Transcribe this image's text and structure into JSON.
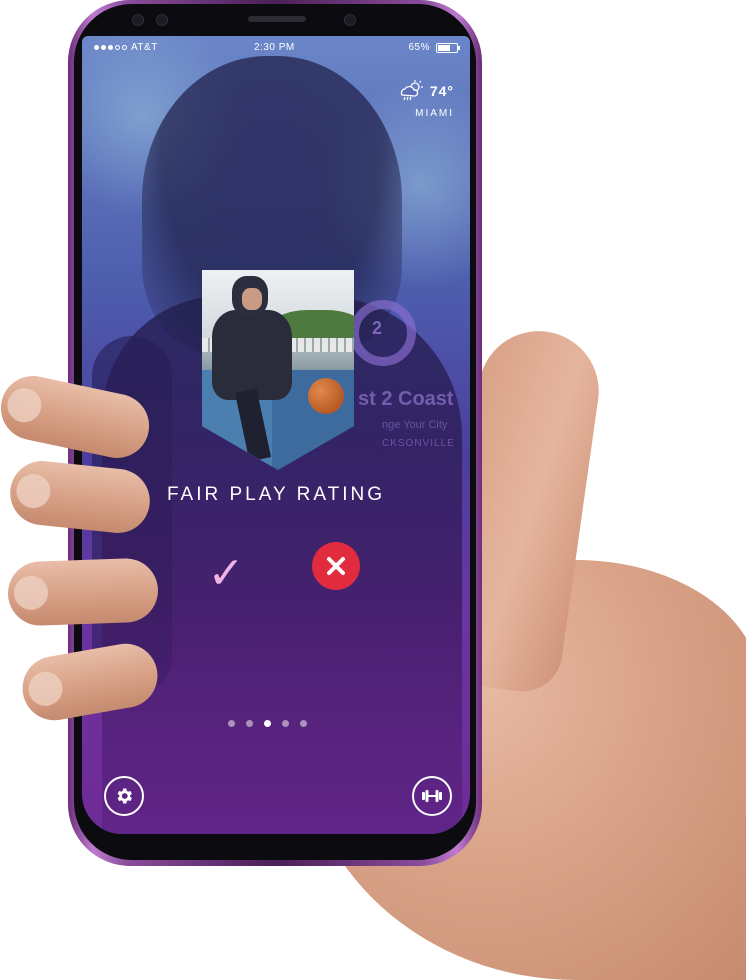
{
  "status_bar": {
    "carrier": "AT&T",
    "time": "2:30 PM",
    "battery": "65%",
    "battery_level": 0.65,
    "signal_bars_filled": 3,
    "signal_bars_total": 5
  },
  "weather": {
    "temperature": "74°",
    "city": "MIAMI",
    "icon": "cloud-rain-sun-icon"
  },
  "background_logo": {
    "mark": "2",
    "line1": "st 2 Coast",
    "line2": "nge Your City",
    "line3": "CKSONVILLE"
  },
  "rating": {
    "title": "FAIR PLAY RATING",
    "approve_icon": "check-icon",
    "reject_icon": "close-icon",
    "approve_glyph": "✓"
  },
  "pager": {
    "count": 5,
    "active_index": 2
  },
  "bottom_bar": {
    "left_icon": "gear-icon",
    "right_icon": "dumbbell-icon"
  },
  "colors": {
    "reject_red": "#e12b3e",
    "check_pink": "#efb3e5",
    "screen_gradient_top": "#6b86c8",
    "screen_gradient_bottom": "#7a2f9a",
    "phone_frame": "#8a4d9c"
  }
}
